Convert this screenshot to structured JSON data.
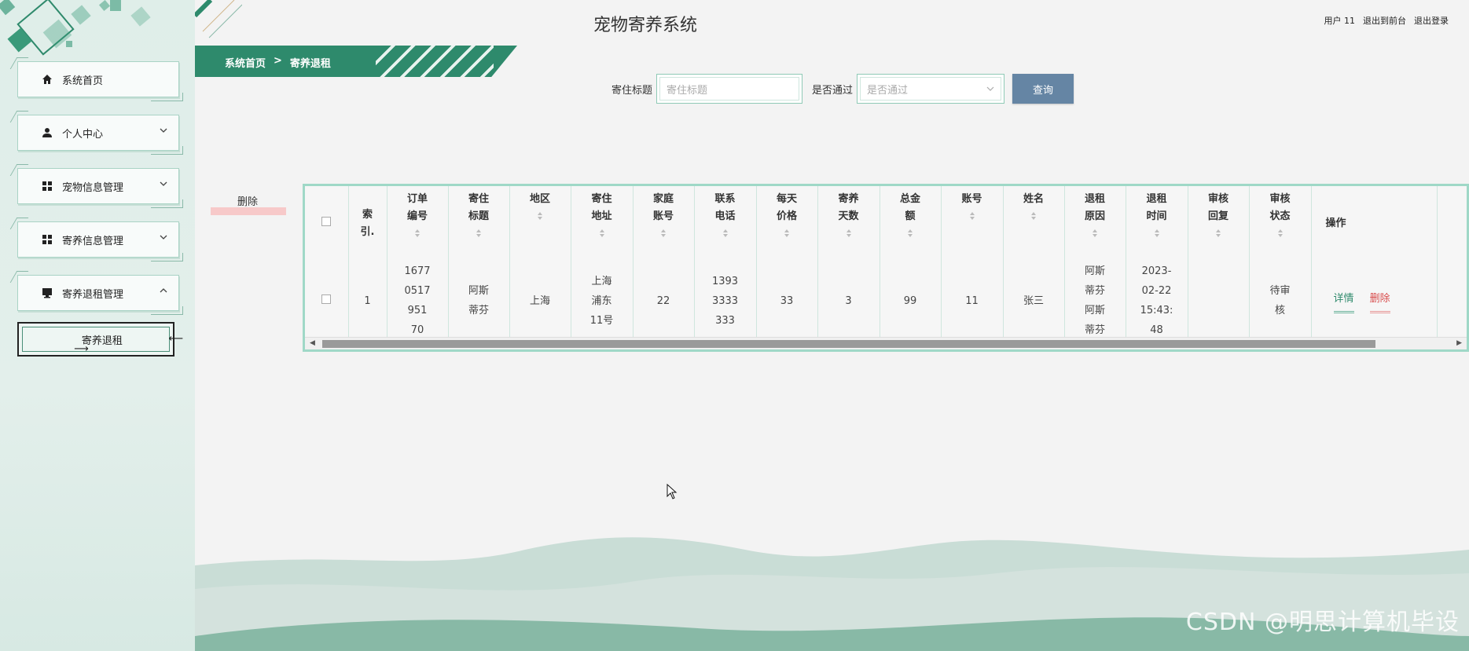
{
  "header": {
    "title": "宠物寄养系统",
    "user": "用户 11",
    "back_front": "退出到前台",
    "logout": "退出登录"
  },
  "breadcrumb": {
    "home": "系统首页",
    "sep": ">",
    "current": "寄养退租"
  },
  "sidebar": {
    "items": [
      {
        "label": "系统首页",
        "icon": "home-icon"
      },
      {
        "label": "个人中心",
        "icon": "user-icon"
      },
      {
        "label": "宠物信息管理",
        "icon": "grid-icon"
      },
      {
        "label": "寄养信息管理",
        "icon": "grid-icon"
      },
      {
        "label": "寄养退租管理",
        "icon": "monitor-icon"
      }
    ],
    "sub_item": "寄养退租"
  },
  "search": {
    "title_label": "寄住标题",
    "title_placeholder": "寄住标题",
    "pass_label": "是否通过",
    "pass_placeholder": "是否通过",
    "query_button": "查询"
  },
  "actions": {
    "delete": "删除"
  },
  "table": {
    "columns": [
      "索引.",
      "订单编号",
      "寄住标题",
      "地区",
      "寄住地址",
      "家庭账号",
      "联系电话",
      "每天价格",
      "寄养天数",
      "总金额",
      "账号",
      "姓名",
      "退租原因",
      "退租时间",
      "审核回复",
      "审核状态",
      "操作"
    ],
    "row": {
      "index": "1",
      "order_no": "16770517951 70",
      "title": "阿斯蒂芬",
      "region": "上海",
      "address": "上海浦东11号",
      "family_account": "22",
      "phone": "13933333333",
      "daily_price": "33",
      "days": "3",
      "total": "99",
      "account": "11",
      "name": "张三",
      "reason": "阿斯蒂芬阿斯蒂芬",
      "time": "2023-02-22 15:43:48",
      "reply": "",
      "status": "待审核",
      "detail": "详情",
      "delete": "删除"
    }
  },
  "watermark": "CSDN @明思计算机毕设"
}
